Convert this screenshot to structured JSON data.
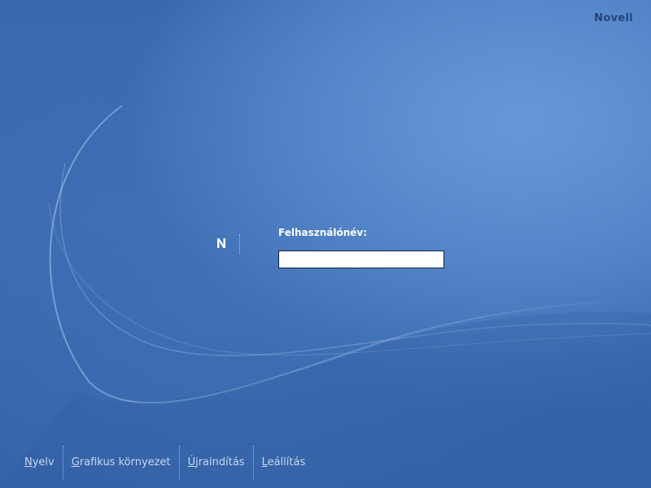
{
  "brand": {
    "name": "Novell"
  },
  "logo": {
    "icon": "novell-n-logo-icon",
    "letter": "N"
  },
  "login": {
    "username_label": "Felhasználónév:",
    "username_value": ""
  },
  "menu": {
    "items": [
      {
        "mnemonic": "N",
        "rest": "yelv"
      },
      {
        "mnemonic": "G",
        "rest": "rafikus környezet"
      },
      {
        "mnemonic": "Ú",
        "rest": "jraindítás"
      },
      {
        "mnemonic": "L",
        "rest": "eállítás"
      }
    ]
  },
  "colors": {
    "background": "#3d6cb2",
    "brand_text": "#24457c",
    "label_text": "#ffffff",
    "menu_text": "#c8d8ef"
  }
}
